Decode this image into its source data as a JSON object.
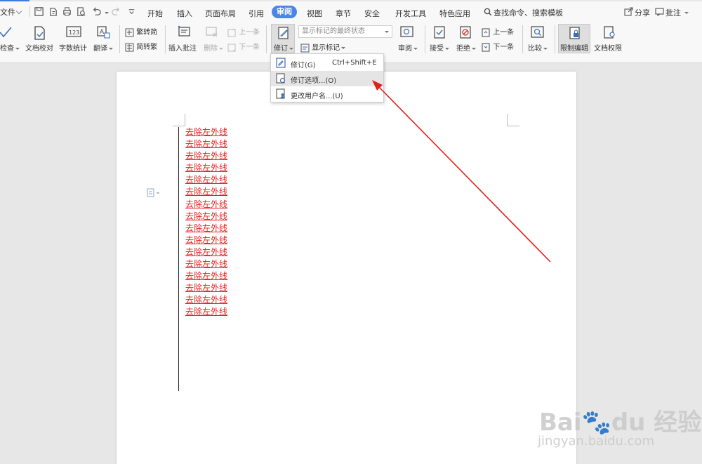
{
  "menu": {
    "file": "文件",
    "tabs": [
      "开始",
      "插入",
      "页面布局",
      "引用",
      "审阅",
      "视图",
      "章节",
      "安全",
      "开发工具",
      "特色应用"
    ],
    "active_tab": "审阅",
    "search": "查找命令、搜索模板",
    "share": "分享",
    "comment": "批注"
  },
  "ribbon": {
    "check": "检查",
    "proofread": "文档校对",
    "word_count": "字数统计",
    "translate": "翻译",
    "trad_to_simp": "繁转简",
    "simp_to_trad": "简转繁",
    "insert_comment": "插入批注",
    "delete": "删除",
    "prev_comment": "上一条",
    "next_comment": "下一条",
    "track_changes": "修订",
    "display_state": "显示标记的最终状态",
    "show_markup": "显示标记",
    "review": "审阅",
    "accept": "接受",
    "reject": "拒绝",
    "prev_change": "上一条",
    "next_change": "下一条",
    "compare": "比较",
    "restrict_edit": "限制编辑",
    "doc_permission": "文档权限"
  },
  "dropdown": {
    "items": [
      {
        "label": "修订(G)",
        "shortcut": "Ctrl+Shift+E"
      },
      {
        "label": "修订选项...(O)",
        "shortcut": ""
      },
      {
        "label": "更改用户名...(U)",
        "shortcut": ""
      }
    ]
  },
  "document": {
    "lines": [
      "去除左外线",
      "去除左外线",
      "去除左外线",
      "去除左外线",
      "去除左外线",
      "去除左外线",
      "去除左外线",
      "去除左外线",
      "去除左外线",
      "去除左外线",
      "去除左外线",
      "去除左外线",
      "去除左外线",
      "去除左外线",
      "去除左外线",
      "去除左外线"
    ]
  },
  "watermark": {
    "logo": "Bai🐾du 经验",
    "url": "jingyan.baidu.com"
  },
  "colors": {
    "accent": "#4a86e8",
    "revision_text": "#e52222",
    "arrow": "#e5201a"
  }
}
